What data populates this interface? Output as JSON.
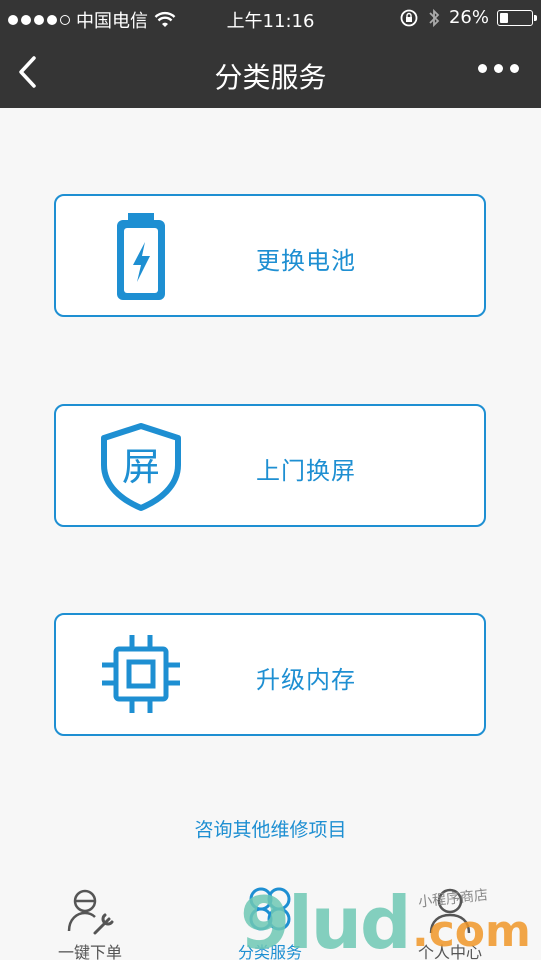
{
  "status_bar": {
    "carrier": "中国电信",
    "time": "上午11:16",
    "battery": "26%",
    "battery_level": 0.26
  },
  "nav": {
    "title": "分类服务",
    "back_icon": "chevron-left-icon",
    "more_icon": "more-dots-icon"
  },
  "services": [
    {
      "label": "更换电池",
      "icon": "battery-charging-icon"
    },
    {
      "label": "上门换屏",
      "icon": "shield-screen-icon",
      "icon_text": "屏"
    },
    {
      "label": "升级内存",
      "icon": "chip-icon"
    }
  ],
  "consult_link": "咨询其他维修项目",
  "tabs": [
    {
      "label": "一键下单",
      "icon": "user-wrench-icon",
      "active": false
    },
    {
      "label": "分类服务",
      "icon": "category-clover-icon",
      "active": true
    },
    {
      "label": "个人中心",
      "icon": "user-icon",
      "active": false
    }
  ],
  "watermark": {
    "main": "9lud",
    "suffix": ".com",
    "small": "小程序商店"
  },
  "colors": {
    "accent": "#1e8fd2",
    "header_bg": "#353535",
    "page_bg": "#f7f7f7"
  }
}
